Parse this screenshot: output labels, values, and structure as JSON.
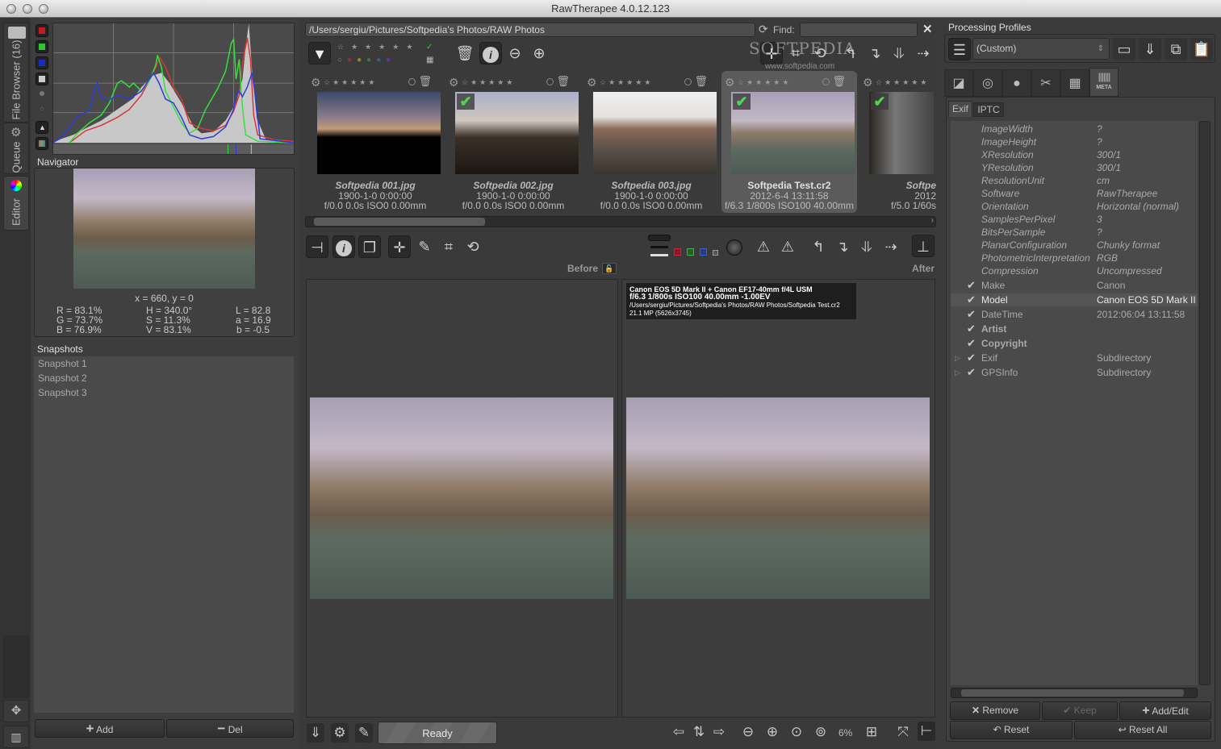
{
  "window": {
    "title": "RawTherapee 4.0.12.123"
  },
  "side_tabs": [
    {
      "label": "File Browser (16)",
      "icon": "folder-icon"
    },
    {
      "label": "Queue",
      "icon": "gears-icon"
    },
    {
      "label": "Editor",
      "icon": "color-wheel-icon"
    }
  ],
  "histogram": {
    "buttons": [
      "red-channel",
      "green-channel",
      "blue-channel",
      "luminance",
      "chroma",
      "raw",
      "bar-toggle",
      "rgb-bar"
    ],
    "colors": {
      "red": "#d8343a",
      "green": "#35e03a",
      "blue": "#2a3cdc",
      "fill": "#c8c8c8"
    }
  },
  "navigator": {
    "title": "Navigator",
    "coords": "x = 660, y = 0",
    "rgb": [
      "R = 83.1%",
      "G = 73.7%",
      "B = 76.9%"
    ],
    "hsv": [
      "H = 340.0°",
      "S = 11.3%",
      "V = 83.1%"
    ],
    "lab": [
      "L = 82.8",
      "a = 16.9",
      "b = -0.5"
    ]
  },
  "snapshots": {
    "title": "Snapshots",
    "items": [
      "Snapshot 1",
      "Snapshot 2",
      "Snapshot 3"
    ],
    "add_label": "Add",
    "del_label": "Del"
  },
  "browser": {
    "path": "/Users/sergiu/Pictures/Softpedia's Photos/RAW Photos",
    "find_label": "Find:",
    "find_value": "",
    "watermark": "SOFTPEDIA",
    "watermark_url": "www.softpedia.com",
    "thumbnails": [
      {
        "name": "Softpedia 001.jpg",
        "date": "1900-1-0 0:00:00",
        "exposure": "f/0.0 0.0s ISO0 0.00mm",
        "selected": false,
        "checked": false
      },
      {
        "name": "Softpedia 002.jpg",
        "date": "1900-1-0 0:00:00",
        "exposure": "f/0.0 0.0s ISO0 0.00mm",
        "selected": false,
        "checked": true
      },
      {
        "name": "Softpedia 003.jpg",
        "date": "1900-1-0 0:00:00",
        "exposure": "f/0.0 0.0s ISO0 0.00mm",
        "selected": false,
        "checked": false
      },
      {
        "name": "Softpedia Test.cr2",
        "date": "2012-6-4 13:11:58",
        "exposure": "f/6.3 1/800s ISO100 40.00mm",
        "selected": true,
        "checked": true
      },
      {
        "name": "Softpe",
        "date": "2012",
        "exposure": "f/5.0 1/60s",
        "selected": false,
        "checked": true
      }
    ]
  },
  "editor": {
    "before_label": "Before",
    "after_label": "After",
    "info": {
      "line1": "Canon EOS 5D Mark II + Canon EF17-40mm f/4L USM",
      "line2": "f/6.3  1/800s  ISO100  40.00mm  -1.00EV",
      "line3": "/Users/sergiu/Pictures/Softpedia's Photos/RAW Photos/Softpedia Test.cr2",
      "line4": "21.1 MP (5626x3745)"
    },
    "status": "Ready",
    "zoom": "6%"
  },
  "right": {
    "profiles_title": "Processing Profiles",
    "profile_selected": "(Custom)",
    "tabs": [
      "exposure",
      "detail",
      "color",
      "transform",
      "raw",
      "META"
    ],
    "subtabs": [
      "Exif",
      "IPTC"
    ],
    "exif": [
      {
        "key": "ImageWidth",
        "value": "?",
        "style": "it"
      },
      {
        "key": "ImageHeight",
        "value": "?",
        "style": "it"
      },
      {
        "key": "XResolution",
        "value": "300/1",
        "style": "it"
      },
      {
        "key": "YResolution",
        "value": "300/1",
        "style": "it"
      },
      {
        "key": "ResolutionUnit",
        "value": "cm",
        "style": "it"
      },
      {
        "key": "Software",
        "value": "RawTherapee",
        "style": "it"
      },
      {
        "key": "Orientation",
        "value": "Horizontal (normal)",
        "style": "it"
      },
      {
        "key": "SamplesPerPixel",
        "value": "3",
        "style": "it"
      },
      {
        "key": "BitsPerSample",
        "value": "?",
        "style": "it"
      },
      {
        "key": "PlanarConfiguration",
        "value": "Chunky format",
        "style": "it"
      },
      {
        "key": "PhotometricInterpretation",
        "value": "RGB",
        "style": "it"
      },
      {
        "key": "Compression",
        "value": "Uncompressed",
        "style": "it"
      },
      {
        "key": "Make",
        "value": "Canon",
        "style": "check"
      },
      {
        "key": "Model",
        "value": "Canon EOS 5D Mark II",
        "style": "check hl"
      },
      {
        "key": "DateTime",
        "value": "2012:06:04 13:11:58",
        "style": "check"
      },
      {
        "key": "Artist",
        "value": "",
        "style": "check bold"
      },
      {
        "key": "Copyright",
        "value": "",
        "style": "check bold"
      },
      {
        "key": "Exif",
        "value": "Subdirectory",
        "style": "check expander"
      },
      {
        "key": "GPSInfo",
        "value": "Subdirectory",
        "style": "check expander"
      }
    ],
    "buttons": {
      "remove": "Remove",
      "keep": "Keep",
      "add_edit": "Add/Edit",
      "reset": "Reset",
      "reset_all": "Reset All"
    }
  }
}
